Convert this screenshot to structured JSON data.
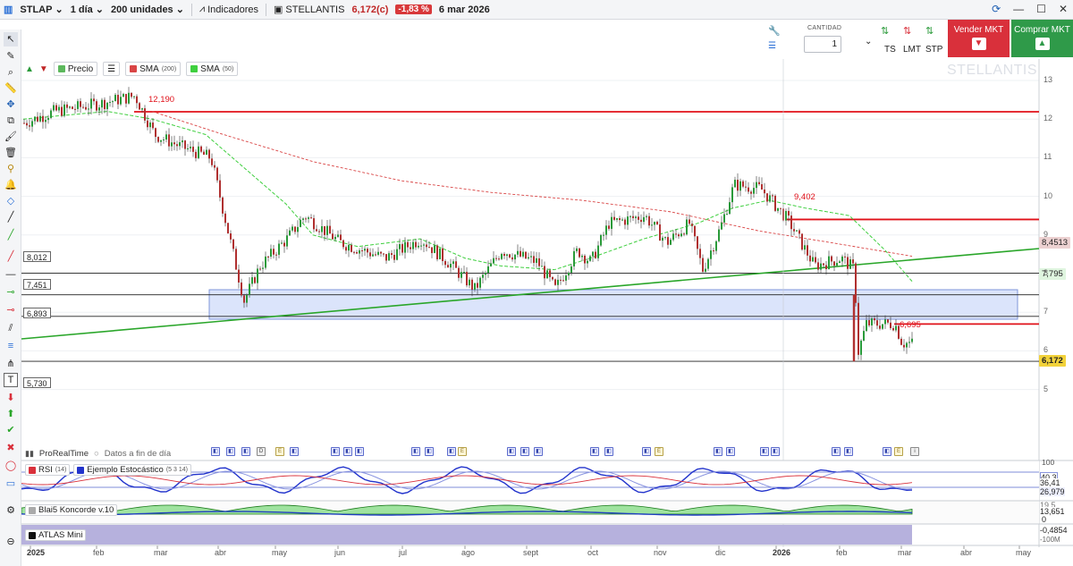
{
  "toolbar": {
    "symbol": "STLAP",
    "timeframe": "1 día",
    "units": "200 unidades",
    "indicators_label": "Indicadores",
    "instrument": "STELLANTIS",
    "last_price": "6,172(c)",
    "change_pct": "-1,83 %",
    "date": "6 mar 2026"
  },
  "legend": {
    "price_label": "Precio",
    "sma200_label": "SMA",
    "sma200_period": "(200)",
    "sma50_label": "SMA",
    "sma50_period": "(50)"
  },
  "order_panel": {
    "quantity_label": "CANTIDAD",
    "quantity_value": "1",
    "ts_label": "TS",
    "lmt_label": "LMT",
    "stp_label": "STP",
    "sell_label": "Vender MKT",
    "buy_label": "Comprar MKT"
  },
  "watermark": "STELLANTIS",
  "price_tags": {
    "left": [
      "8,012",
      "7,451",
      "6,893",
      "5,730"
    ],
    "line_12190": "12,190",
    "line_9402": "9,402",
    "line_6695": "6,695"
  },
  "axis_tags": [
    {
      "text": "8,4513",
      "color": "#e8c8c8"
    },
    {
      "text": "7,795",
      "color": "#dff5df"
    },
    {
      "text": "6,172",
      "color": "#f2d23a"
    }
  ],
  "y_axis": [
    "13",
    "12",
    "11",
    "10",
    "9",
    "8",
    "7",
    "6",
    "5"
  ],
  "x_axis": [
    "2025",
    "feb",
    "mar",
    "abr",
    "may",
    "jun",
    "jul",
    "ago",
    "sept",
    "oct",
    "nov",
    "dic",
    "2026",
    "feb",
    "mar",
    "abr",
    "may"
  ],
  "realtime": {
    "label": "ProRealTime",
    "mode": "Datos a fin de día"
  },
  "rsi_panel": {
    "rsi_label": "RSI",
    "rsi_period": "(14)",
    "stoch_label": "Ejemplo Estocástico",
    "stoch_params": "(5 3 14)",
    "values": [
      "40,3",
      "36,41",
      "26,979"
    ],
    "level_100": "100"
  },
  "koncorde_panel": {
    "label": "Blai5 Koncorde v.10",
    "values": [
      "19,5",
      "13,651",
      "0"
    ]
  },
  "atlas_panel": {
    "label": "ATLAS Mini",
    "values": [
      "-0,4854",
      "-100M"
    ]
  },
  "chart_data": {
    "type": "line",
    "title": "",
    "ylim": [
      4.8,
      13.3
    ],
    "ylabel": "",
    "x_range": [
      "2025-01",
      "2026-05"
    ],
    "series": [
      {
        "name": "Precio",
        "x": [
          "ene",
          "feb",
          "mar",
          "abr",
          "abr",
          "may",
          "jun",
          "jul",
          "ago",
          "sept",
          "oct",
          "nov",
          "dic",
          "2026",
          "feb",
          "mar"
        ],
        "values": [
          11.9,
          12.1,
          11.3,
          8.7,
          7.2,
          9.1,
          8.7,
          8.7,
          8.1,
          8.0,
          9.3,
          9.5,
          10.1,
          9.5,
          8.4,
          6.2
        ]
      }
    ]
  },
  "colors": {
    "sma200": "#d94545",
    "sma50": "#3fcf3f",
    "bull": "#2a9a3a",
    "bear": "#b03030",
    "hline": "#e0111a",
    "trend": "#2aa62a",
    "zone": "#dbe4fb"
  }
}
